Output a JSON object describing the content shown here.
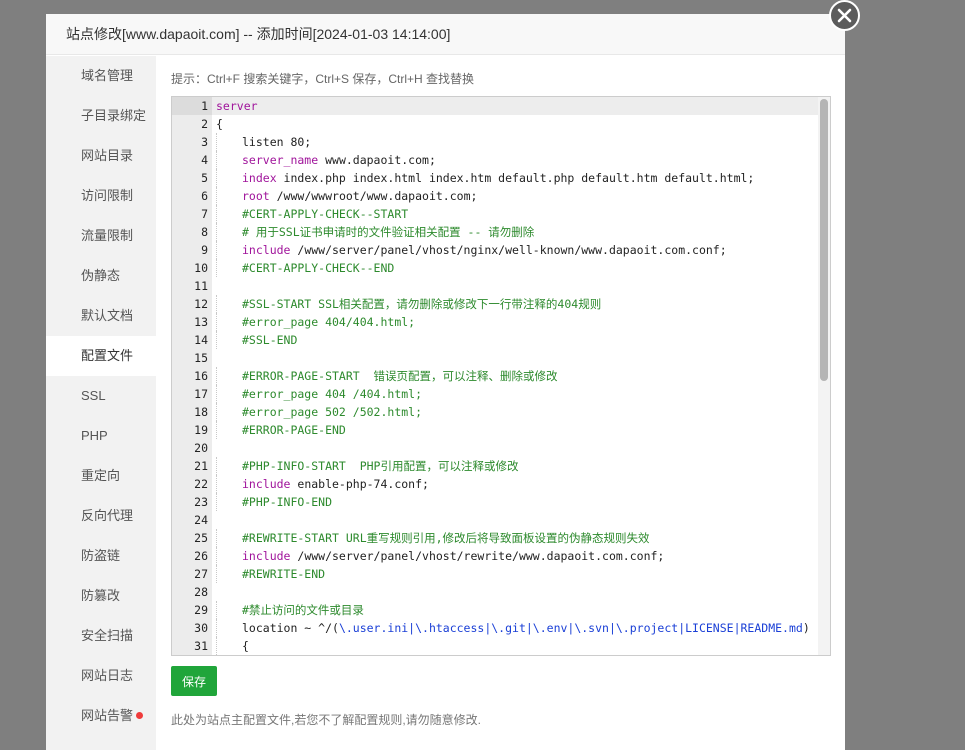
{
  "modal": {
    "title": "站点修改[www.dapaoit.com] -- 添加时间[2024-01-03 14:14:00]"
  },
  "sidebar": {
    "items": [
      {
        "label": "域名管理"
      },
      {
        "label": "子目录绑定"
      },
      {
        "label": "网站目录"
      },
      {
        "label": "访问限制"
      },
      {
        "label": "流量限制"
      },
      {
        "label": "伪静态"
      },
      {
        "label": "默认文档"
      },
      {
        "label": "配置文件",
        "active": true
      },
      {
        "label": "SSL"
      },
      {
        "label": "PHP"
      },
      {
        "label": "重定向"
      },
      {
        "label": "反向代理"
      },
      {
        "label": "防盗链"
      },
      {
        "label": "防篡改"
      },
      {
        "label": "安全扫描"
      },
      {
        "label": "网站日志"
      },
      {
        "label": "网站告警",
        "alert": true
      }
    ]
  },
  "content": {
    "tip": "提示：Ctrl+F 搜索关键字，Ctrl+S 保存，Ctrl+H 查找替换",
    "save_label": "保存",
    "footer_note": "此处为站点主配置文件,若您不了解配置规则,请勿随意修改."
  },
  "editor": {
    "lines": [
      {
        "n": "1",
        "indent": 0,
        "parts": [
          {
            "t": "server",
            "c": "kw"
          }
        ]
      },
      {
        "n": "2",
        "indent": 0,
        "parts": [
          {
            "t": "{",
            "c": ""
          }
        ]
      },
      {
        "n": "3",
        "indent": 1,
        "parts": [
          {
            "t": "listen 80;",
            "c": ""
          }
        ]
      },
      {
        "n": "4",
        "indent": 1,
        "parts": [
          {
            "t": "server_name",
            "c": "kw"
          },
          {
            "t": " www.dapaoit.com;",
            "c": ""
          }
        ]
      },
      {
        "n": "5",
        "indent": 1,
        "parts": [
          {
            "t": "index",
            "c": "kw"
          },
          {
            "t": " index.php index.html index.htm default.php default.htm default.html;",
            "c": ""
          }
        ]
      },
      {
        "n": "6",
        "indent": 1,
        "parts": [
          {
            "t": "root",
            "c": "kw"
          },
          {
            "t": " /www/wwwroot/www.dapaoit.com;",
            "c": ""
          }
        ]
      },
      {
        "n": "7",
        "indent": 1,
        "parts": [
          {
            "t": "#CERT-APPLY-CHECK--START",
            "c": "cm"
          }
        ]
      },
      {
        "n": "8",
        "indent": 1,
        "parts": [
          {
            "t": "# 用于SSL证书申请时的文件验证相关配置 -- 请勿删除",
            "c": "cm"
          }
        ]
      },
      {
        "n": "9",
        "indent": 1,
        "parts": [
          {
            "t": "include",
            "c": "kw"
          },
          {
            "t": " /www/server/panel/vhost/nginx/well-known/www.dapaoit.com.conf;",
            "c": ""
          }
        ]
      },
      {
        "n": "10",
        "indent": 1,
        "parts": [
          {
            "t": "#CERT-APPLY-CHECK--END",
            "c": "cm"
          }
        ]
      },
      {
        "n": "11",
        "indent": 0,
        "parts": []
      },
      {
        "n": "12",
        "indent": 1,
        "parts": [
          {
            "t": "#SSL-START SSL相关配置，请勿删除或修改下一行带注释的404规则",
            "c": "cm"
          }
        ]
      },
      {
        "n": "13",
        "indent": 1,
        "parts": [
          {
            "t": "#error_page 404/404.html;",
            "c": "cm"
          }
        ]
      },
      {
        "n": "14",
        "indent": 1,
        "parts": [
          {
            "t": "#SSL-END",
            "c": "cm"
          }
        ]
      },
      {
        "n": "15",
        "indent": 0,
        "parts": []
      },
      {
        "n": "16",
        "indent": 1,
        "parts": [
          {
            "t": "#ERROR-PAGE-START  错误页配置，可以注释、删除或修改",
            "c": "cm"
          }
        ]
      },
      {
        "n": "17",
        "indent": 1,
        "parts": [
          {
            "t": "#error_page 404 /404.html;",
            "c": "cm"
          }
        ]
      },
      {
        "n": "18",
        "indent": 1,
        "parts": [
          {
            "t": "#error_page 502 /502.html;",
            "c": "cm"
          }
        ]
      },
      {
        "n": "19",
        "indent": 1,
        "parts": [
          {
            "t": "#ERROR-PAGE-END",
            "c": "cm"
          }
        ]
      },
      {
        "n": "20",
        "indent": 0,
        "parts": []
      },
      {
        "n": "21",
        "indent": 1,
        "parts": [
          {
            "t": "#PHP-INFO-START  PHP引用配置，可以注释或修改",
            "c": "cm"
          }
        ]
      },
      {
        "n": "22",
        "indent": 1,
        "parts": [
          {
            "t": "include",
            "c": "kw"
          },
          {
            "t": " enable-php-74.conf;",
            "c": ""
          }
        ]
      },
      {
        "n": "23",
        "indent": 1,
        "parts": [
          {
            "t": "#PHP-INFO-END",
            "c": "cm"
          }
        ]
      },
      {
        "n": "24",
        "indent": 0,
        "parts": []
      },
      {
        "n": "25",
        "indent": 1,
        "parts": [
          {
            "t": "#REWRITE-START URL重写规则引用,修改后将导致面板设置的伪静态规则失效",
            "c": "cm"
          }
        ]
      },
      {
        "n": "26",
        "indent": 1,
        "parts": [
          {
            "t": "include",
            "c": "kw"
          },
          {
            "t": " /www/server/panel/vhost/rewrite/www.dapaoit.com.conf;",
            "c": ""
          }
        ]
      },
      {
        "n": "27",
        "indent": 1,
        "parts": [
          {
            "t": "#REWRITE-END",
            "c": "cm"
          }
        ]
      },
      {
        "n": "28",
        "indent": 0,
        "parts": []
      },
      {
        "n": "29",
        "indent": 1,
        "parts": [
          {
            "t": "#禁止访问的文件或目录",
            "c": "cm"
          }
        ]
      },
      {
        "n": "30",
        "indent": 1,
        "parts": [
          {
            "t": "location ~ ^/(",
            "c": ""
          },
          {
            "t": "\\.user.ini|\\.htaccess|\\.git|\\.env|\\.svn|\\.project|LICENSE|README.md",
            "c": "rx"
          },
          {
            "t": ")",
            "c": ""
          }
        ]
      },
      {
        "n": "31",
        "indent": 1,
        "parts": [
          {
            "t": "{",
            "c": ""
          }
        ]
      }
    ]
  },
  "colors": {
    "primary_green": "#20a53a",
    "keyword": "#a0149b",
    "comment": "#2d8a2d",
    "regex": "#1a3fd6",
    "alert_dot": "#ef3b3b"
  }
}
